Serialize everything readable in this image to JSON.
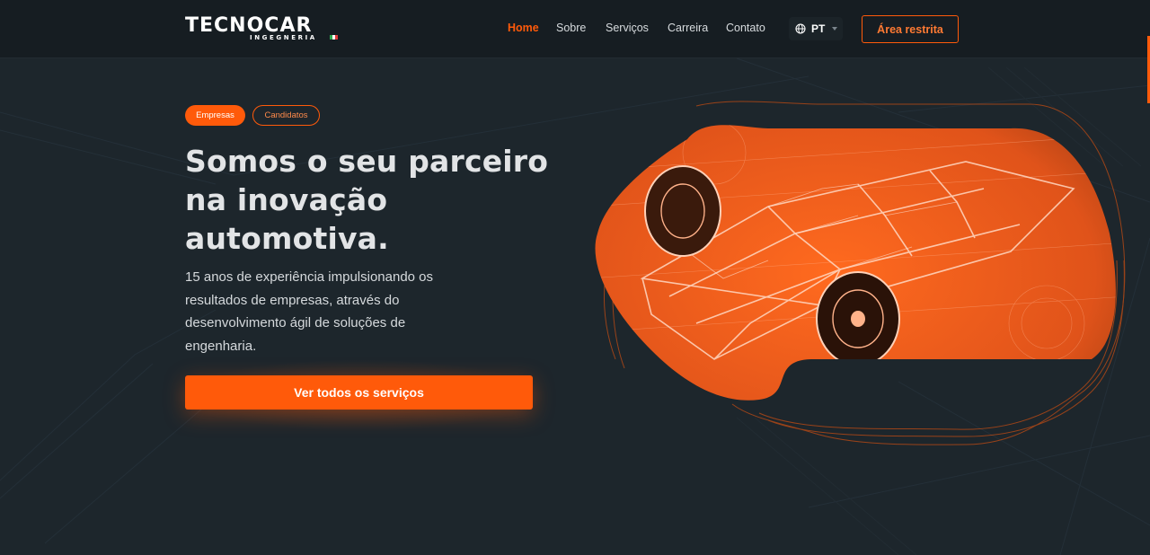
{
  "header": {
    "logo_main": "TECNOCAR",
    "logo_sub": "INGEGNERIA",
    "nav": [
      {
        "label": "Home",
        "active": true
      },
      {
        "label": "Sobre",
        "active": false
      },
      {
        "label": "Serviços",
        "active": false
      },
      {
        "label": "Carreira",
        "active": false
      },
      {
        "label": "Contato",
        "active": false
      }
    ],
    "language": "PT",
    "restricted_area": "Área restrita"
  },
  "hero": {
    "chips": [
      "Empresas",
      "Candidatos"
    ],
    "title_line1": "Somos o seu parceiro",
    "title_line2": "na inovação",
    "title_line3": "automotiva.",
    "description": "15 anos de experiência impulsionando os resultados de empresas, através do desenvolvimento ágil de soluções de engenharia.",
    "cta": "Ver todos os serviços"
  },
  "colors": {
    "accent": "#ff5a0a",
    "background": "#1d262c",
    "header_bg": "#161d22"
  },
  "icons": {
    "language": "globe-icon",
    "dropdown": "chevron-down-icon"
  }
}
